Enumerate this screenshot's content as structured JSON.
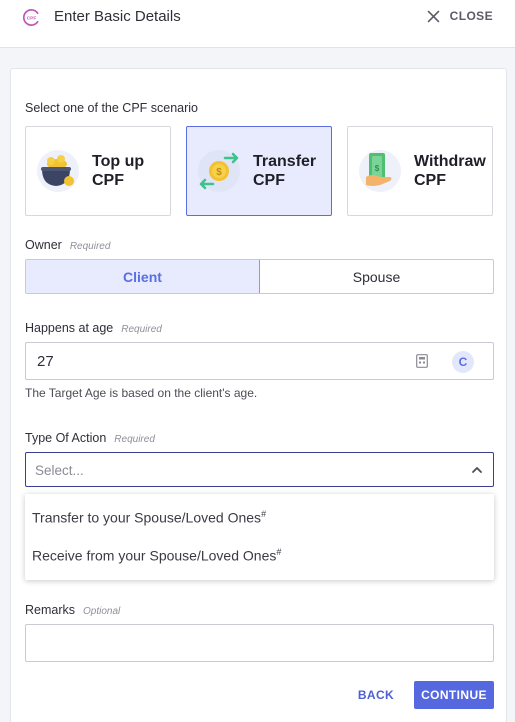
{
  "header": {
    "logo_text": "CPF",
    "title": "Enter Basic Details",
    "close_label": "CLOSE"
  },
  "scenario": {
    "label": "Select one of the CPF scenario",
    "options": [
      {
        "label_line1": "Top up",
        "label_line2": "CPF",
        "icon": "pot-of-gold-icon",
        "selected": false
      },
      {
        "label_line1": "Transfer",
        "label_line2": "CPF",
        "icon": "coin-transfer-icon",
        "selected": true
      },
      {
        "label_line1": "Withdraw",
        "label_line2": "CPF",
        "icon": "cash-in-hand-icon",
        "selected": false
      }
    ]
  },
  "owner": {
    "label": "Owner",
    "tag": "Required",
    "options": [
      "Client",
      "Spouse"
    ],
    "selected": "Client"
  },
  "age": {
    "label": "Happens at age",
    "tag": "Required",
    "value": "27",
    "badge": "C",
    "helper": "The Target Age is based on the client's age."
  },
  "action": {
    "label": "Type Of Action",
    "tag": "Required",
    "placeholder": "Select...",
    "options": [
      {
        "text": "Transfer to your Spouse/Loved Ones",
        "mark": "#"
      },
      {
        "text": "Receive from your Spouse/Loved Ones",
        "mark": "#"
      }
    ]
  },
  "remarks": {
    "label": "Remarks",
    "tag": "Optional",
    "value": ""
  },
  "footer": {
    "back_label": "BACK",
    "continue_label": "CONTINUE"
  },
  "colors": {
    "accent": "#5568e0",
    "selected_bg": "#e7ebfd",
    "logo": "#c157b8"
  }
}
